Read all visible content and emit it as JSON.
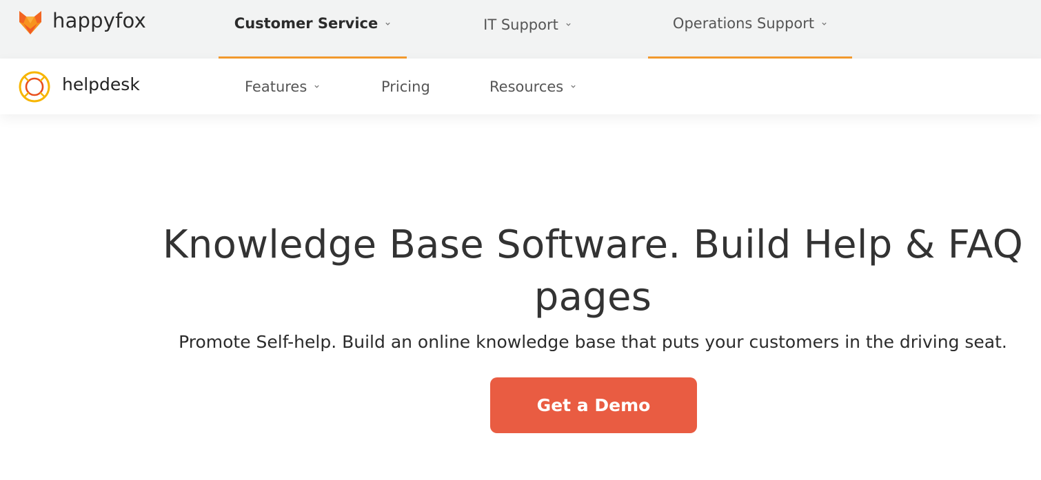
{
  "topbar": {
    "brand": {
      "name": "happyfox",
      "icon": "fox-logo-icon"
    },
    "tabs": [
      {
        "label": "Customer Service",
        "selected": true
      },
      {
        "label": "IT Support",
        "selected": false
      },
      {
        "label": "Operations Support",
        "selected": false
      }
    ]
  },
  "subnav": {
    "brand": {
      "name": "helpdesk",
      "icon": "lifebuoy-logo-icon"
    },
    "links": [
      {
        "label": "Features",
        "has_dropdown": true
      },
      {
        "label": "Pricing",
        "has_dropdown": false
      },
      {
        "label": "Resources",
        "has_dropdown": true
      }
    ]
  },
  "hero": {
    "title_line1": "Knowledge Base Software. Build Help & FAQ",
    "title_line2": "pages",
    "subtitle": "Promote Self-help. Build an online knowledge base that puts your customers in the driving seat.",
    "cta_label": "Get a Demo"
  },
  "colors": {
    "accent_orange": "#f49b2d",
    "cta_red": "#e95c42",
    "topbar_bg": "#f2f3f3"
  }
}
